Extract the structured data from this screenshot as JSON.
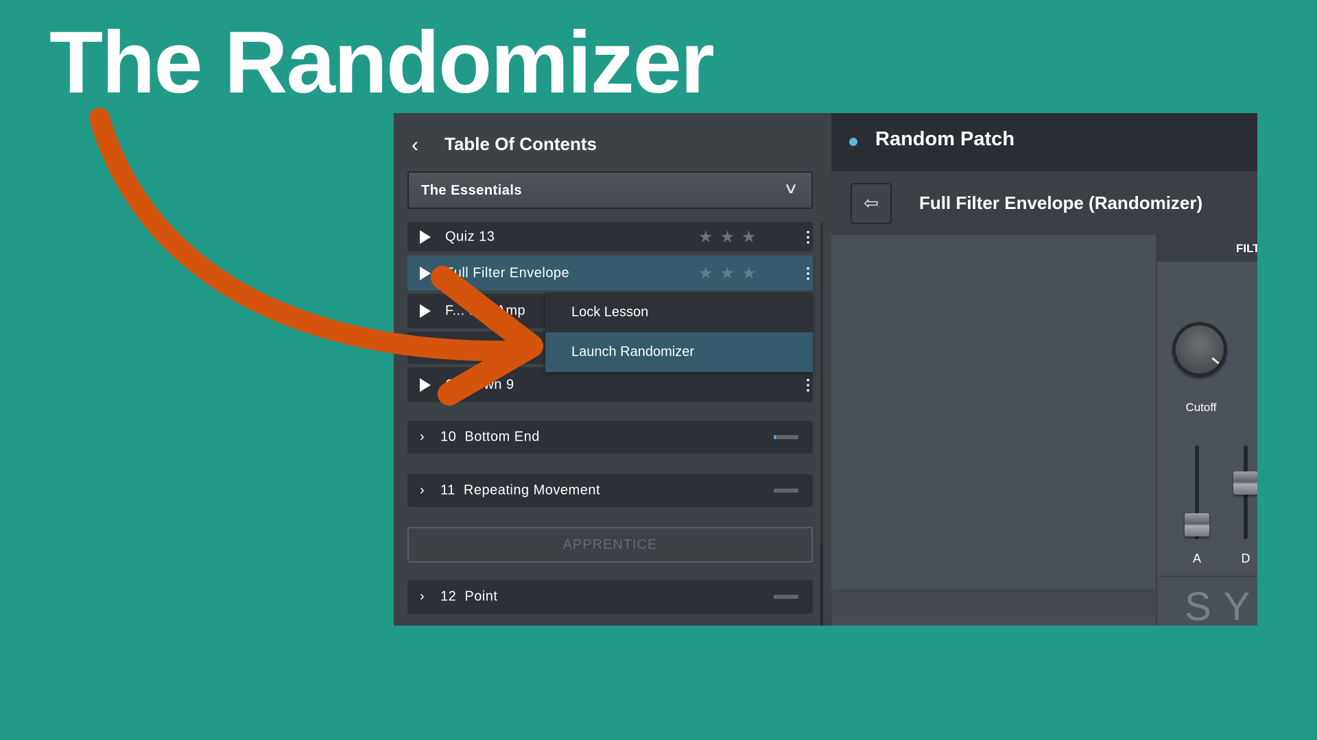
{
  "headline": "The Randomizer",
  "toc": {
    "title": "Table Of Contents",
    "dropdown_value": "The Essentials",
    "lessons": [
      {
        "label": "Quiz 13",
        "stars": 0,
        "selected": false
      },
      {
        "label": "Full Filter Envelope",
        "stars": 0,
        "selected": true
      },
      {
        "label": "F... and Amp",
        "selected": false
      },
      {
        "label": "O... Own 9",
        "selected": false
      }
    ],
    "context_menu": {
      "items": [
        "Lock Lesson",
        "Launch Randomizer"
      ],
      "highlighted": "Launch Randomizer"
    },
    "chapters": [
      {
        "number": "10",
        "title": "Bottom End",
        "progress": 0.08
      },
      {
        "number": "11",
        "title": "Repeating Movement",
        "progress": 0
      },
      {
        "number": "12",
        "title": "Point",
        "progress": 0
      }
    ],
    "section_label": "APPRENTICE"
  },
  "patch": {
    "header": "Random Patch",
    "subtitle": "Full Filter Envelope (Randomizer)",
    "filter_header": "FILT",
    "knob_label": "Cutoff",
    "sliders": [
      {
        "label": "A",
        "value": 0.15
      },
      {
        "label": "D",
        "value": 0.6
      }
    ],
    "footer_text": "SY"
  },
  "colors": {
    "background": "#219a88",
    "arrow": "#d4540e",
    "selected_row": "#355b6c",
    "accent_dot": "#5fb6e0"
  }
}
